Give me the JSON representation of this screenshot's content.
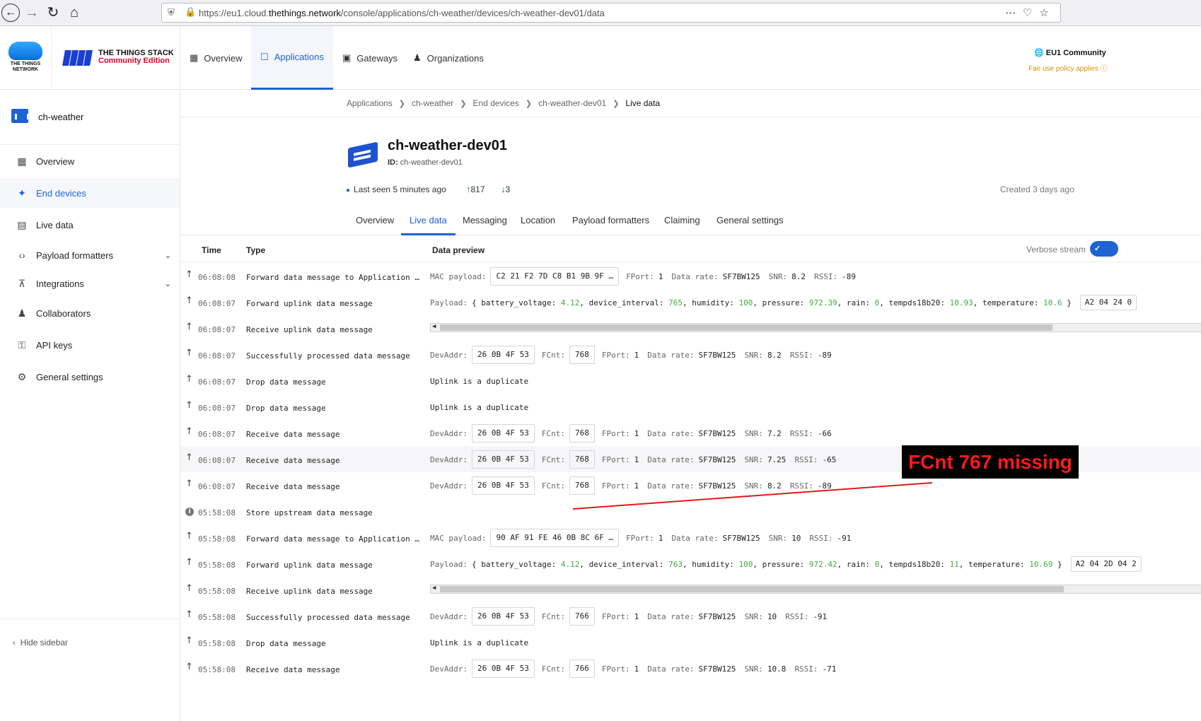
{
  "browser": {
    "url_prefix": "https://eu1.cloud.",
    "url_domain": "thethings.network",
    "url_suffix": "/console/applications/ch-weather/devices/ch-weather-dev01/data"
  },
  "header": {
    "ttn_logo_text": "THE THINGS NETWORK",
    "product_name": "THE THINGS STACK",
    "product_edition": "Community Edition",
    "nav": {
      "overview": "Overview",
      "applications": "Applications",
      "gateways": "Gateways",
      "organizations": "Organizations"
    },
    "cluster": "EU1 Community",
    "fair_use": "Fair use policy applies"
  },
  "sidebar": {
    "app_name": "ch-weather",
    "items": [
      {
        "label": "Overview",
        "icon": "grid-icon"
      },
      {
        "label": "End devices",
        "icon": "devices-icon"
      },
      {
        "label": "Live data",
        "icon": "chart-icon"
      },
      {
        "label": "Payload formatters",
        "icon": "code-icon"
      },
      {
        "label": "Integrations",
        "icon": "integrations-icon"
      },
      {
        "label": "Collaborators",
        "icon": "people-icon"
      },
      {
        "label": "API keys",
        "icon": "key-icon"
      },
      {
        "label": "General settings",
        "icon": "gear-icon"
      }
    ],
    "hide": "Hide sidebar"
  },
  "breadcrumb": [
    "Applications",
    "ch-weather",
    "End devices",
    "ch-weather-dev01",
    "Live data"
  ],
  "device": {
    "name": "ch-weather-dev01",
    "id_label": "ID:",
    "id": "ch-weather-dev01",
    "last_seen": "Last seen 5 minutes ago",
    "uplinks": "817",
    "downlinks": "3",
    "created": "Created 3 days ago"
  },
  "tabs": [
    "Overview",
    "Live data",
    "Messaging",
    "Location",
    "Payload formatters",
    "Claiming",
    "General settings"
  ],
  "table": {
    "col_time": "Time",
    "col_type": "Type",
    "col_preview": "Data preview",
    "verbose_label": "Verbose stream"
  },
  "labels": {
    "mac": "MAC payload:",
    "payload": "Payload:",
    "devaddr": "DevAddr:",
    "fcnt": "FCnt:",
    "fport": "FPort:",
    "datarate": "Data rate:",
    "snr": "SNR:",
    "rssi": "RSSI:"
  },
  "rows": [
    {
      "time": "06:08:08",
      "type": "Forward data message to Application S…",
      "kind": "mac",
      "mac": "C2 21 F2 7D C8 B1 9B 9F …",
      "fport": "1",
      "datarate": "SF7BW125",
      "snr": "8.2",
      "rssi": "-89"
    },
    {
      "time": "06:08:07",
      "type": "Forward uplink data message",
      "kind": "payload",
      "payload": {
        "battery_voltage": "4.12",
        "device_interval": "765",
        "humidity": "100",
        "pressure": "972.39",
        "rain": "0",
        "tempds18b20": "10.93",
        "temperature": "10.6"
      },
      "tail": "A2 04 24 0"
    },
    {
      "time": "06:08:07",
      "type": "Receive uplink data message",
      "kind": "none"
    },
    {
      "time": "06:08:07",
      "type": "Successfully processed data message",
      "kind": "dev",
      "devaddr": "26 0B 4F 53",
      "fcnt": "768",
      "fport": "1",
      "datarate": "SF7BW125",
      "snr": "8.2",
      "rssi": "-89"
    },
    {
      "time": "06:08:07",
      "type": "Drop data message",
      "kind": "text",
      "text": "Uplink is a duplicate"
    },
    {
      "time": "06:08:07",
      "type": "Drop data message",
      "kind": "text",
      "text": "Uplink is a duplicate"
    },
    {
      "time": "06:08:07",
      "type": "Receive data message",
      "kind": "dev",
      "devaddr": "26 0B 4F 53",
      "fcnt": "768",
      "fport": "1",
      "datarate": "SF7BW125",
      "snr": "7.2",
      "rssi": "-66"
    },
    {
      "time": "06:08:07",
      "type": "Receive data message",
      "kind": "dev",
      "devaddr": "26 0B 4F 53",
      "fcnt": "768",
      "fport": "1",
      "datarate": "SF7BW125",
      "snr": "7.25",
      "rssi": "-65",
      "highlight": true
    },
    {
      "time": "06:08:07",
      "type": "Receive data message",
      "kind": "dev",
      "devaddr": "26 0B 4F 53",
      "fcnt": "768",
      "fport": "1",
      "datarate": "SF7BW125",
      "snr": "8.2",
      "rssi": "-89"
    },
    {
      "time": "05:58:08",
      "type": "Store upstream data message",
      "kind": "none",
      "icon": "info"
    },
    {
      "time": "05:58:08",
      "type": "Forward data message to Application S…",
      "kind": "mac",
      "mac": "90 AF 91 FE 46 0B 8C 6F …",
      "fport": "1",
      "datarate": "SF7BW125",
      "snr": "10",
      "rssi": "-91"
    },
    {
      "time": "05:58:08",
      "type": "Forward uplink data message",
      "kind": "payload",
      "payload": {
        "battery_voltage": "4.12",
        "device_interval": "763",
        "humidity": "100",
        "pressure": "972.42",
        "rain": "0",
        "tempds18b20": "11",
        "temperature": "10.69"
      },
      "tail": "A2 04 2D 04 2"
    },
    {
      "time": "05:58:08",
      "type": "Receive uplink data message",
      "kind": "none"
    },
    {
      "time": "05:58:08",
      "type": "Successfully processed data message",
      "kind": "dev",
      "devaddr": "26 0B 4F 53",
      "fcnt": "766",
      "fport": "1",
      "datarate": "SF7BW125",
      "snr": "10",
      "rssi": "-91"
    },
    {
      "time": "05:58:08",
      "type": "Drop data message",
      "kind": "text",
      "text": "Uplink is a duplicate"
    },
    {
      "time": "05:58:08",
      "type": "Receive data message",
      "kind": "dev",
      "devaddr": "26 0B 4F 53",
      "fcnt": "766",
      "fport": "1",
      "datarate": "SF7BW125",
      "snr": "10.8",
      "rssi": "-71"
    }
  ],
  "annotation": {
    "text": "FCnt 767 missing",
    "color": "#ff1a1a"
  }
}
